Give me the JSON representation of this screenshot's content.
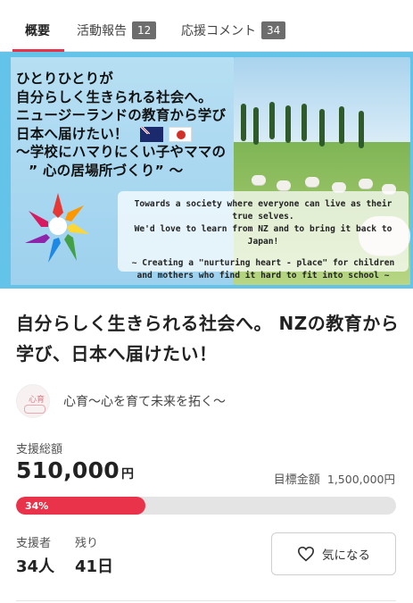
{
  "tabs": [
    {
      "label": "概要",
      "count": null,
      "active": true
    },
    {
      "label": "活動報告",
      "count": "12",
      "active": false
    },
    {
      "label": "応援コメント",
      "count": "34",
      "active": false
    }
  ],
  "hero": {
    "lines": [
      "ひとりひとりが",
      "自分らしく生きられる社会へ。",
      "ニュージーランドの教育から学び",
      "日本へ届けたい！",
      "〜学校にハマりにくい子やママの",
      "” 心の居場所づくり” 〜"
    ],
    "caption": [
      "Towards a society where everyone can live as their true selves.",
      "We'd love to learn from NZ and to bring it back to Japan!",
      "~ Creating a \"nurturing heart - place\" for children",
      "and mothers who find it hard to fit into school ~"
    ]
  },
  "project": {
    "title": "自分らしく生きられる社会へ。 NZの教育から学び、日本へ届けたい！",
    "owner_name": "心育〜心を育て未来を拓く〜",
    "owner_avatar_text": "心育"
  },
  "funding": {
    "raised_label": "支援総額",
    "raised_amount": "510,000",
    "currency": "円",
    "target_label": "目標金額",
    "target_amount": "1,500,000円",
    "progress_percent": 34,
    "progress_text": "34%",
    "supporters_label": "支援者",
    "supporters_value": "34人",
    "remaining_label": "残り",
    "remaining_value": "41日",
    "favorite_label": "気になる"
  },
  "colors": {
    "accent": "#e8334a",
    "badge": "#6d6d6d",
    "hero_bg": "#64c3e8"
  },
  "icons": [
    "heart-outline-icon",
    "nz-flag-icon",
    "japan-flag-icon",
    "colorful-hands-logo"
  ]
}
